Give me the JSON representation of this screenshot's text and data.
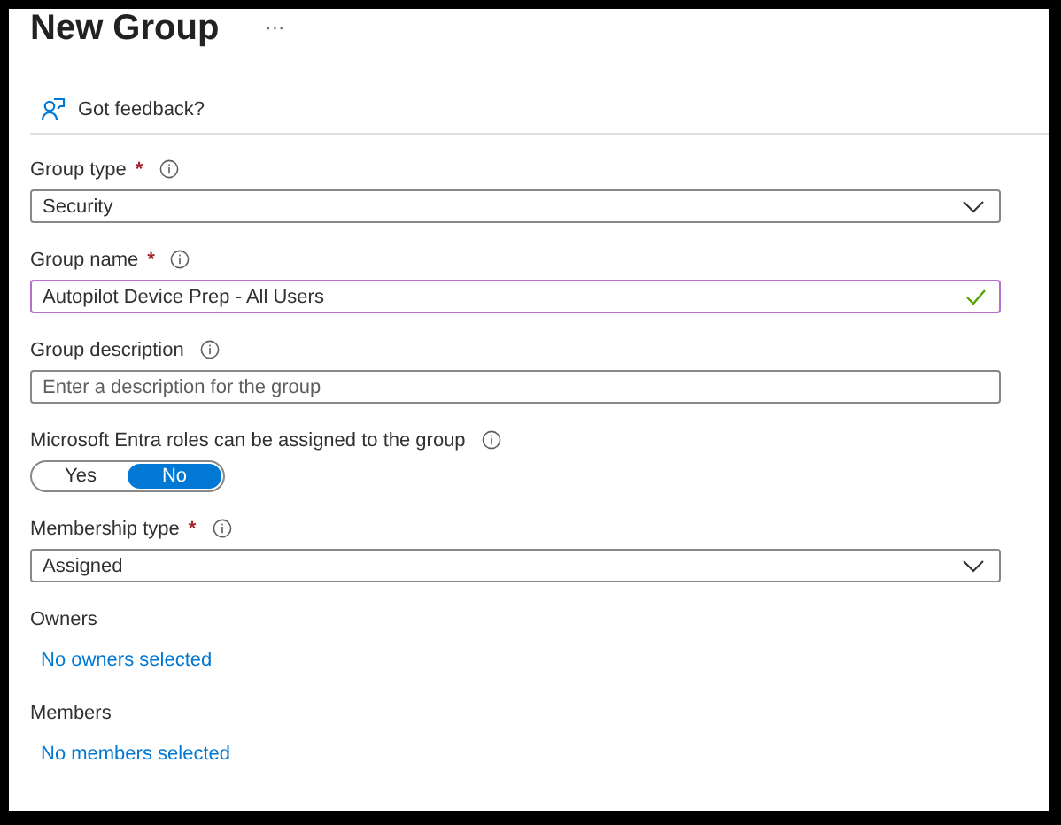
{
  "title": "New Group",
  "more": "···",
  "feedback": "Got feedback?",
  "fields": [
    {
      "kind": "dropdown",
      "label": "Group type",
      "required_mark": "*",
      "info": true,
      "value": "Security"
    },
    {
      "kind": "text",
      "label": "Group name",
      "required_mark": "*",
      "info": true,
      "value": "Autopilot Device Prep - All Users",
      "valid": true,
      "focused": true
    },
    {
      "kind": "text",
      "label": "Group description",
      "info": true,
      "placeholder": "Enter a description for the group",
      "valid": false,
      "focused": false
    },
    {
      "kind": "toggle",
      "label": "Microsoft Entra roles can be assigned to the group",
      "info": true,
      "options": [
        {
          "label": "Yes",
          "selected": false
        },
        {
          "label": "No",
          "selected": true
        }
      ]
    },
    {
      "kind": "dropdown",
      "label": "Membership type",
      "required_mark": "*",
      "info": true,
      "value": "Assigned"
    },
    {
      "kind": "link",
      "label": "Owners",
      "info": false,
      "value": "No owners selected"
    },
    {
      "kind": "link",
      "label": "Members",
      "info": false,
      "value": "No members selected"
    }
  ]
}
